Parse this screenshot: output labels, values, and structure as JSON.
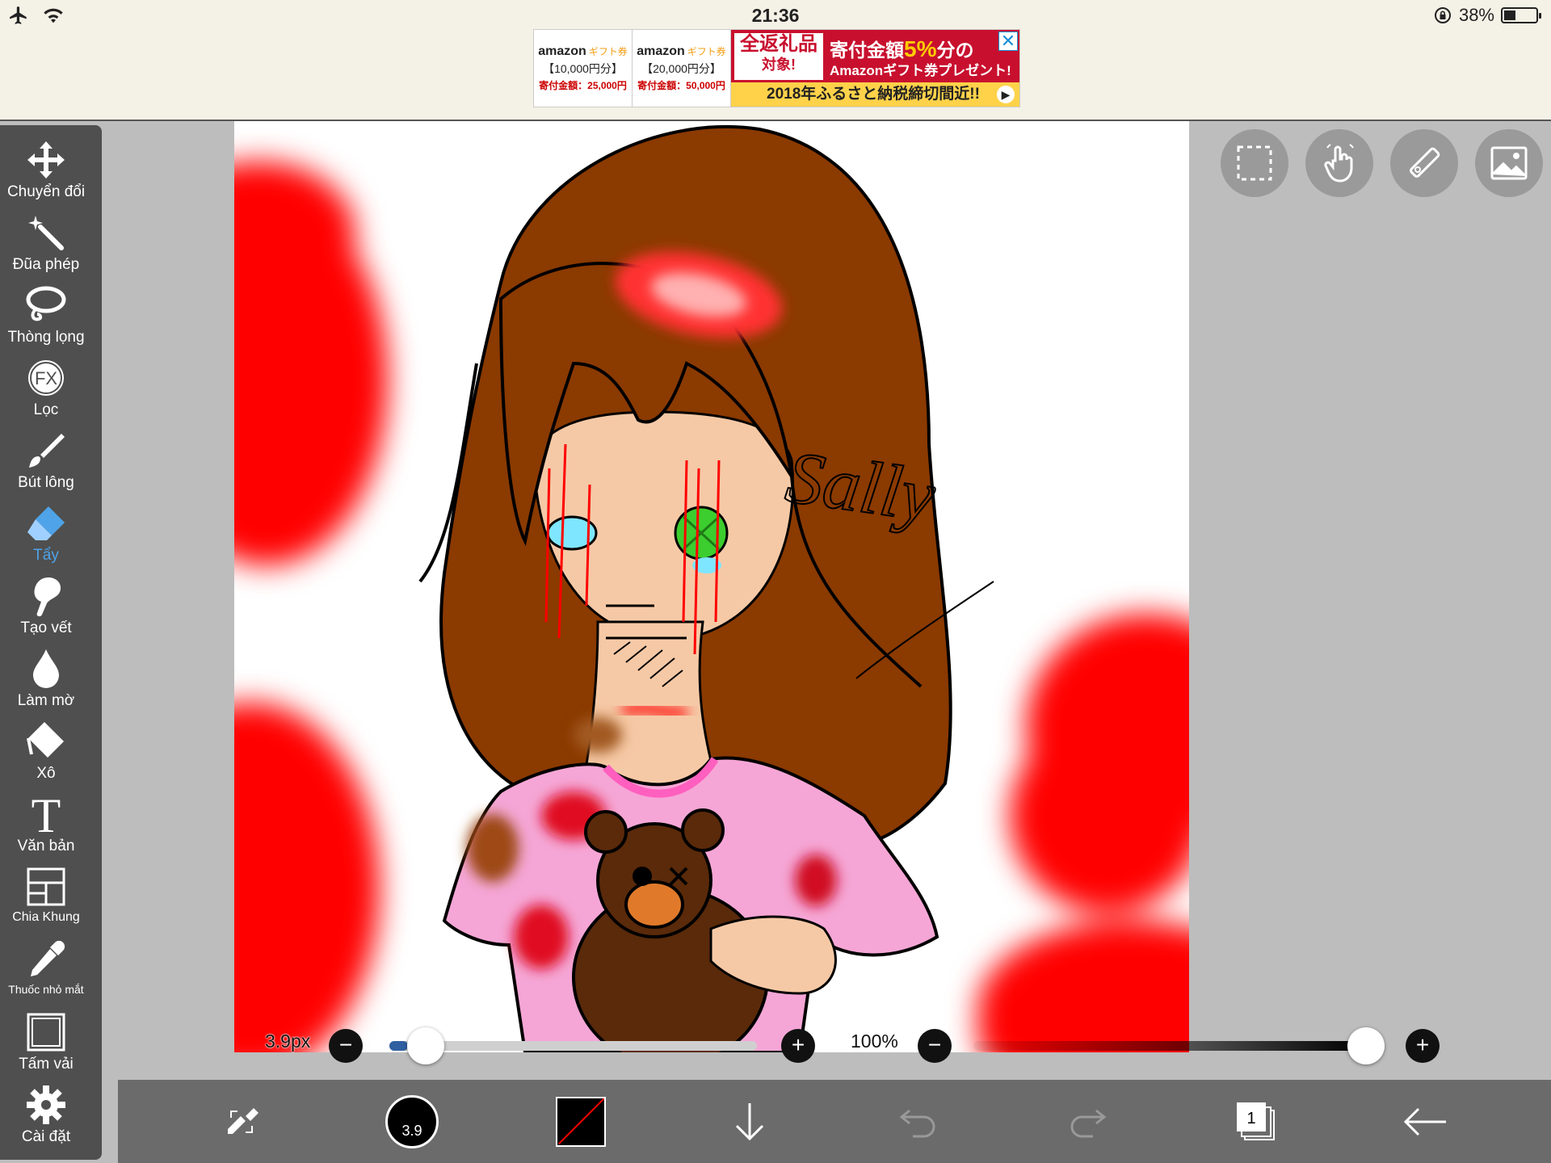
{
  "status": {
    "time": "21:36",
    "battery_percent": "38%",
    "battery_level": 0.38
  },
  "ad": {
    "cards": [
      {
        "brand": "amazon",
        "tag": "ギフト券",
        "amount": "【10,000円分】",
        "donation": "寄付金額：25,000円"
      },
      {
        "brand": "amazon",
        "tag": "ギフト券",
        "amount": "【20,000円分】",
        "donation": "寄付金額：50,000円"
      }
    ],
    "box_line1": "全返礼品",
    "box_line2": "対象!",
    "headline_prefix": "寄付金額",
    "headline_percent": "5%",
    "headline_suffix": "分の",
    "tagline": "Amazonギフト券プレゼント!",
    "strip": "2018年ふるさと納税締切間近!!",
    "close": "✕"
  },
  "tools": [
    {
      "name": "tool-transform",
      "icon": "move-arrows-icon",
      "label": "Chuyển đổi"
    },
    {
      "name": "tool-magic-wand",
      "icon": "magic-wand-icon",
      "label": "Đũa phép"
    },
    {
      "name": "tool-lasso",
      "icon": "lasso-icon",
      "label": "Thòng lọng"
    },
    {
      "name": "tool-filter",
      "icon": "fx-icon",
      "label": "Lọc"
    },
    {
      "name": "tool-brush",
      "icon": "brush-icon",
      "label": "Bút lông"
    },
    {
      "name": "tool-eraser",
      "icon": "eraser-icon",
      "label": "Tẩy",
      "active": true
    },
    {
      "name": "tool-smudge",
      "icon": "smudge-icon",
      "label": "Tạo vết"
    },
    {
      "name": "tool-blur",
      "icon": "drop-icon",
      "label": "Làm mờ"
    },
    {
      "name": "tool-bucket",
      "icon": "bucket-icon",
      "label": "Xô"
    },
    {
      "name": "tool-text",
      "icon": "text-icon",
      "label": "Văn bản"
    },
    {
      "name": "tool-frame-divider",
      "icon": "frame-icon",
      "label": "Chia Khung"
    },
    {
      "name": "tool-eyedropper",
      "icon": "eyedropper-icon",
      "label": "Thuốc nhỏ mắt"
    },
    {
      "name": "tool-canvas",
      "icon": "canvas-icon",
      "label": "Tấm vải"
    },
    {
      "name": "tool-settings",
      "icon": "gear-icon",
      "label": "Cài đặt"
    }
  ],
  "canvas": {
    "signature": "Sally"
  },
  "brush_size": {
    "label": "3.9px",
    "value": 3.9,
    "fraction": 0.05
  },
  "opacity": {
    "label": "100%",
    "value": 100
  },
  "bottom": {
    "brush_size_badge": "3.9",
    "layer_count": "1"
  },
  "colors": {
    "accent": "#4fa3e8",
    "toolbar": "#4f4f4f",
    "bottombar": "#6b6b6b",
    "blood": "#ff0000",
    "hair": "#8b3a00"
  }
}
